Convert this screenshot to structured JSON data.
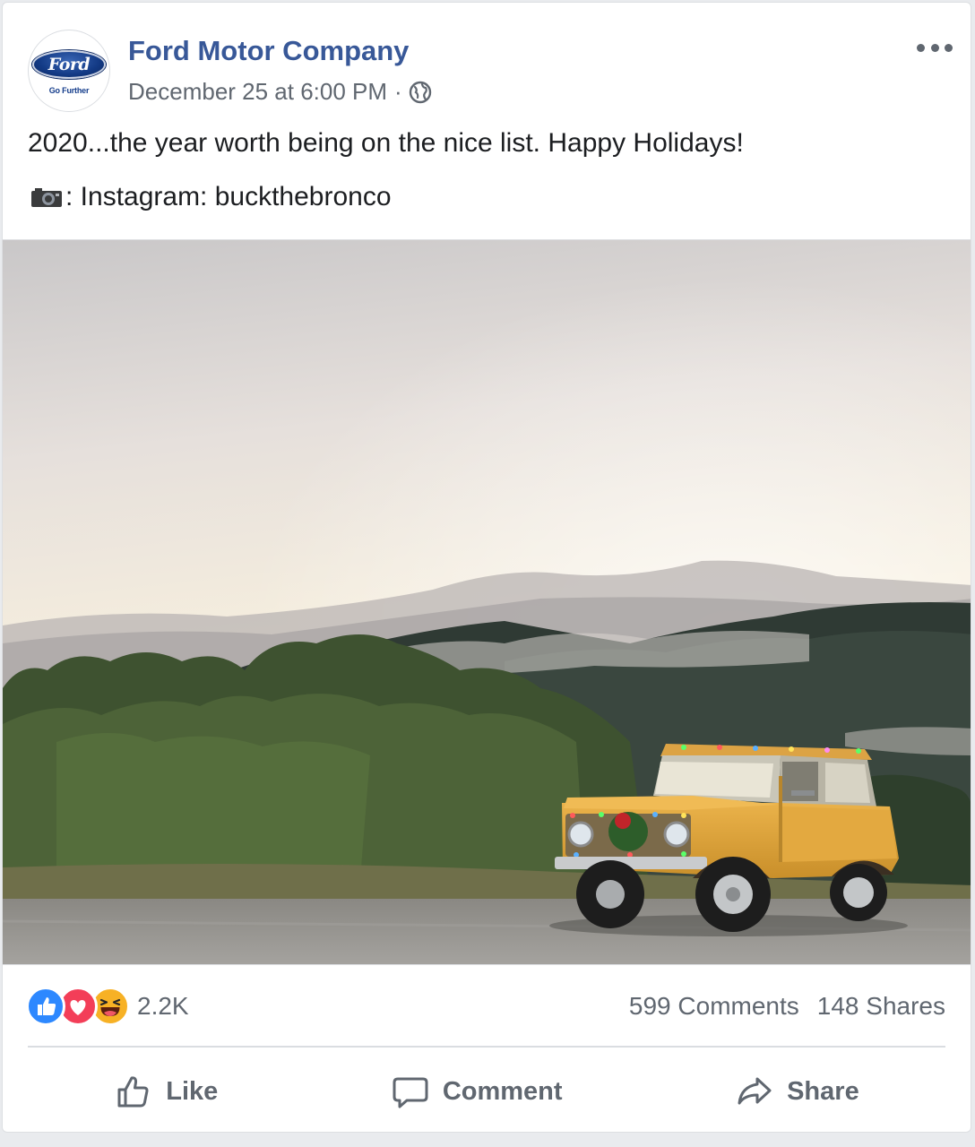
{
  "page": {
    "name": "Ford Motor Company",
    "logo_text": "Ford",
    "logo_tagline": "Go Further"
  },
  "post": {
    "timestamp": "December 25 at 6:00 PM",
    "separator": "·",
    "privacy_icon": "globe-icon",
    "text": "2020...the year worth being on the nice list. Happy Holidays!",
    "credit": ": Instagram: buckthebronco",
    "credit_icon": "camera-icon"
  },
  "engagement": {
    "reaction_icons": [
      "like-reaction-icon",
      "love-reaction-icon",
      "haha-reaction-icon"
    ],
    "reaction_count": "2.2K",
    "comments": "599 Comments",
    "shares": "148 Shares"
  },
  "actions": {
    "like": "Like",
    "comment": "Comment",
    "share": "Share"
  },
  "colors": {
    "page_name": "#385898",
    "meta": "#606770",
    "like_blue": "#2d88ff",
    "love_red": "#f33e58",
    "haha_yellow": "#f7b125",
    "vehicle_body": "#e0a43a"
  }
}
